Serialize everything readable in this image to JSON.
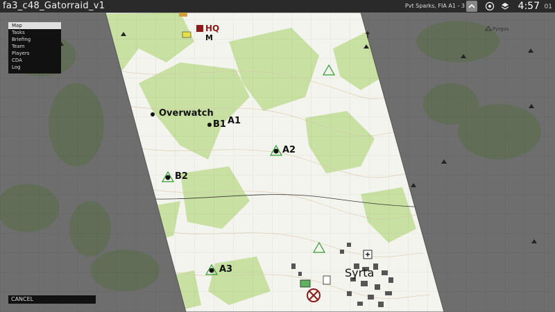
{
  "topbar": {
    "title": "fa3_c48_Gatorraid_v1",
    "unit_info": "Pvt Sparks, FIA  A1 - 3",
    "time": "4:57",
    "seconds": "01"
  },
  "menu": {
    "items": [
      {
        "label": "Map",
        "active": true
      },
      {
        "label": "Tasks",
        "active": false
      },
      {
        "label": "Briefing",
        "active": false
      },
      {
        "label": "Team",
        "active": false
      },
      {
        "label": "Players",
        "active": false
      },
      {
        "label": "CDA",
        "active": false
      },
      {
        "label": "Log",
        "active": false
      }
    ],
    "cancel_label": "CANCEL"
  },
  "map": {
    "markers": {
      "overwatch": "Overwatch",
      "a1": "A1",
      "b1": "B1",
      "a2": "A2",
      "b2": "B2",
      "a3": "A3",
      "hq": "HQ",
      "m": "M"
    },
    "places": {
      "town": "Syrta",
      "village": "Pyrgos"
    },
    "colors": {
      "map_bg": "#f4f4ee",
      "forest": "#c8e0a2",
      "fog": "#6e6e6e",
      "marker_green": "#2e9a2e",
      "marker_red": "#8b1a1a"
    }
  }
}
